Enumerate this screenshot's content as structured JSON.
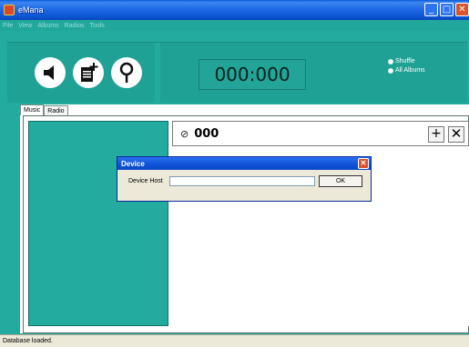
{
  "window": {
    "title": "eMana",
    "minimize": "_",
    "maximize": "□",
    "close": "✕"
  },
  "menu": {
    "items": [
      "File",
      "View",
      "Albums",
      "Radios",
      "Tools"
    ]
  },
  "controls": {
    "volume_icon": "speaker-icon",
    "add_icon": "add-document-icon",
    "search_icon": "search-icon",
    "counter": "000:000",
    "shuffle_label": "Shuffle",
    "all_albums_label": "All Albums"
  },
  "tabs": [
    {
      "label": "Music",
      "selected": true
    },
    {
      "label": "Radio",
      "selected": false
    }
  ],
  "track": {
    "icon": "⊘",
    "title": "000",
    "add_label": "+",
    "remove_label": "✕"
  },
  "dialog": {
    "title": "Device",
    "close": "✕",
    "host_label": "Device Host",
    "host_value": "",
    "ok_label": "OK"
  },
  "status": {
    "text": "Database loaded."
  },
  "colors": {
    "teal": "#24ab9f",
    "titlebar_blue": "#0b54d2"
  }
}
